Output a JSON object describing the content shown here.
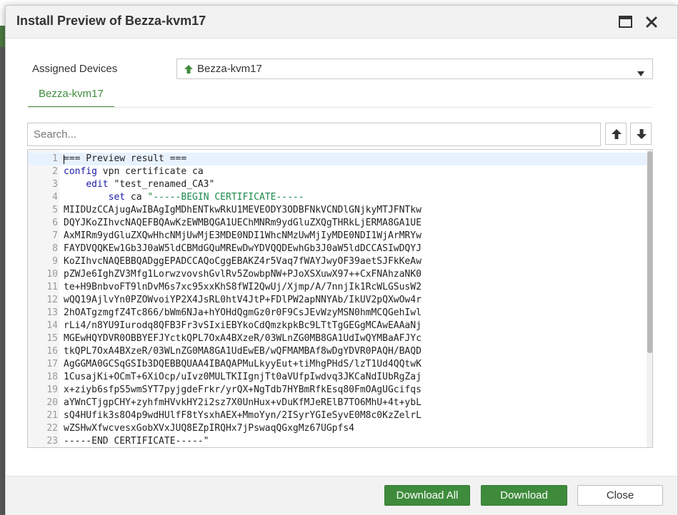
{
  "dialog": {
    "title": "Install Preview of Bezza-kvm17"
  },
  "assigned": {
    "label": "Assigned Devices",
    "selected_device": "Bezza-kvm17"
  },
  "tab": {
    "label": "Bezza-kvm17"
  },
  "search": {
    "placeholder": "Search..."
  },
  "code": {
    "lines": [
      "=== Preview result ===",
      "config vpn certificate ca",
      "    edit \"test_renamed_CA3\"",
      "        set ca \"-----BEGIN CERTIFICATE-----",
      "MIIDUzCCAjugAwIBAgIgMDhENTkwRkU1MEVEODY3ODBFNkVCNDlGNjkyMTJFNTkw",
      "DQYJKoZIhvcNAQEFBQAwKzEWMBQGA1UEChMNRm9ydGluZXQgTHRkLjERMA8GA1UE",
      "AxMIRm9ydGluZXQwHhcNMjUwMjE3MDE0NDI1WhcNMzUwMjIyMDE0NDI1WjArMRYw",
      "FAYDVQQKEw1Gb3J0aW5ldCBMdGQuMREwDwYDVQQDEwhGb3J0aW5ldDCCASIwDQYJ",
      "KoZIhvcNAQEBBQADggEPADCCAQoCggEBAKZ4r5Vaq7fWAYJwyOF39aetSJFkKeAw",
      "pZWJe6IghZV3Mfg1LorwzvovshGvlRv5ZowbpNW+PJoXSXuwX97++CxFNAhzaNK0",
      "te+H9BnbvoFT9lnDvM6s7xc95xxKhS8fWI2QwUj/Xjmp/A/7nnjIk1RcWLGSusW2",
      "wQQ19AjlvYn0PZOWvoiYP2X4JsRL0htV4JtP+FDlPW2apNNYAb/IkUV2pQXwOw4r",
      "2hOATgzmgfZ4Tc866/bWm6NJa+hYOHdQgmGz0r0F9CsJEvWzyMSN0hmMCQGehIwl",
      "rLi4/n8YU9Iurodq8QFB3Fr3vSIxiEBYkoCdQmzkpkBc9LTtTgGEGgMCAwEAAaNj",
      "MGEwHQYDVR0OBBYEFJYctkQPL7OxA4BXzeR/03WLnZG0MB8GA1UdIwQYMBaAFJYc",
      "tkQPL7OxA4BXzeR/03WLnZG0MA8GA1UdEwEB/wQFMAMBAf8wDgYDVR0PAQH/BAQD",
      "AgGGMA0GCSqGSIb3DQEBBQUAA4IBAQAPMuLkyyEut+tiMhgPHdS/lzT1Ud4QQtwK",
      "1CusajKi+OCmT+6XiOcp/uIvz0MULTKIIgnjTt0aVUfpIwdvq3JKCaNdIUbRgZaj",
      "x+ziyb6sfpS5wmSYT7pyjgdeFrkr/yrQX+NgTdb7HYBmRfkEsq80FmOAgUGcifqs",
      "aYWnCTjgpCHY+zyhfmHVvkHY2i2sz7X0UnHux+vDuKfMJeRElB7TO6MhU+4t+ybL",
      "sQ4HUfik3s8O4p9wdHUlfF8tYsxhAEX+MmoYyn/2ISyrYGIeSyvE0M8c0KzZelrL",
      "wZSHwXfwcvesxGobXVxJUQ8EZpIRQHx7jPswaqQGxgMz67UGpfs4",
      "-----END CERTIFICATE-----\""
    ],
    "current_line": 1
  },
  "footer": {
    "download_all_label": "Download All",
    "download_label": "Download",
    "close_label": "Close"
  },
  "colors": {
    "accent": "#3f8b3c",
    "keyword": "#1a1aa6",
    "string_green": "#1a8a4a"
  }
}
